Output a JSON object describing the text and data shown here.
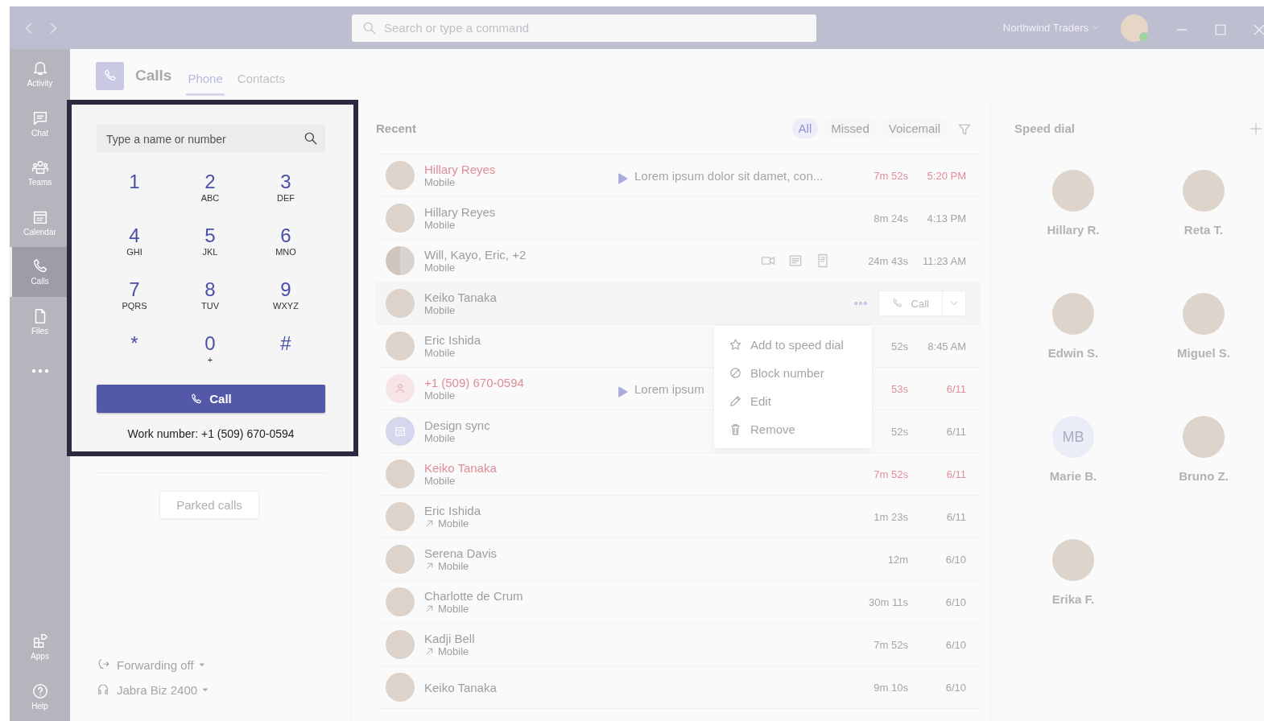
{
  "title_bar": {
    "search": {
      "placeholder": "Search or type a command"
    },
    "org": "Northwind Traders"
  },
  "rail": {
    "top": [
      {
        "label": "Activity",
        "selected": false
      },
      {
        "label": "Chat",
        "selected": false
      },
      {
        "label": "Teams",
        "selected": false
      },
      {
        "label": "Calendar",
        "selected": false
      },
      {
        "label": "Calls",
        "selected": true
      },
      {
        "label": "Files",
        "selected": false
      },
      {
        "selected": false
      }
    ],
    "bottom": [
      {
        "label": "Apps",
        "selected": false
      },
      {
        "label": "Help",
        "selected": false
      }
    ]
  },
  "app": {
    "title": "Calls",
    "tabs": [
      {
        "label": "Phone",
        "selected": true
      },
      {
        "label": "Contacts",
        "selected": false
      }
    ]
  },
  "dial_pad": {
    "search": {
      "placeholder": "Type a name or number"
    },
    "keys": [
      {
        "digit": "1"
      },
      {
        "digit": "2",
        "letters": "ABC"
      },
      {
        "digit": "3",
        "letters": "DEF"
      },
      {
        "digit": "4",
        "letters": "GHI"
      },
      {
        "digit": "5",
        "letters": "JKL"
      },
      {
        "digit": "6",
        "letters": "MNO"
      },
      {
        "digit": "7",
        "letters": "PQRS"
      },
      {
        "digit": "8",
        "letters": "TUV"
      },
      {
        "digit": "9",
        "letters": "WXYZ"
      },
      {
        "digit": "*"
      },
      {
        "digit": "0",
        "letters": "+"
      },
      {
        "digit": "#"
      }
    ],
    "call_button": "Call",
    "work_number": "Work number: +1 (509) 670-0594"
  },
  "parked_calls": "Parked calls",
  "forwarding": "Forwarding off",
  "device": "Jabra Biz 2400",
  "recent": {
    "title": "Recent",
    "filters": [
      {
        "label": "All",
        "selected": true
      },
      {
        "label": "Missed",
        "selected": false
      },
      {
        "label": "Voicemail",
        "selected": false
      }
    ],
    "rows": [
      {
        "name": "Hillary Reyes",
        "detail": "Mobile",
        "avatar": {
          "kind": "photo"
        },
        "kind": "voicemail",
        "preview": "Lorem ipsum dolor sit damet, con...",
        "missed": true,
        "outgoing": false,
        "selected": false,
        "duration": "7m 52s",
        "time": "5:20 PM"
      },
      {
        "name": "Hillary Reyes",
        "detail": "Mobile",
        "avatar": {
          "kind": "photo"
        },
        "kind": "plain",
        "missed": false,
        "outgoing": false,
        "selected": false,
        "duration": "8m 24s",
        "time": "4:13 PM"
      },
      {
        "name": "Will, Kayo, Eric, +2",
        "detail": "Mobile",
        "avatar": {
          "kind": "group"
        },
        "kind": "meeting",
        "missed": false,
        "outgoing": false,
        "selected": false,
        "duration": "24m 43s",
        "time": "11:23 AM"
      },
      {
        "name": "Keiko Tanaka",
        "detail": "Mobile",
        "avatar": {
          "kind": "photo"
        },
        "kind": "plain",
        "call_button": "Call",
        "missed": false,
        "outgoing": false,
        "selected": true
      },
      {
        "name": "Eric Ishida",
        "detail": "Mobile",
        "avatar": {
          "kind": "photo"
        },
        "kind": "plain",
        "missed": false,
        "outgoing": false,
        "selected": false,
        "duration": "52s",
        "time": "8:45 AM"
      },
      {
        "name": "+1 (509) 670-0594",
        "detail": "Mobile",
        "avatar": {
          "kind": "phone"
        },
        "kind": "voicemail",
        "preview": "Lorem ipsum",
        "missed": true,
        "outgoing": false,
        "selected": false,
        "duration": "53s",
        "time": "6/11"
      },
      {
        "name": "Design sync",
        "detail": "Mobile",
        "avatar": {
          "kind": "meeting"
        },
        "kind": "plain",
        "missed": false,
        "outgoing": false,
        "selected": false,
        "duration": "52s",
        "time": "6/11"
      },
      {
        "name": "Keiko Tanaka",
        "detail": "Mobile",
        "avatar": {
          "kind": "photo"
        },
        "kind": "plain",
        "missed": true,
        "outgoing": false,
        "selected": false,
        "duration": "7m 52s",
        "time": "6/11"
      },
      {
        "name": "Eric Ishida",
        "detail": "Mobile",
        "avatar": {
          "kind": "photo"
        },
        "kind": "plain",
        "missed": false,
        "outgoing": true,
        "selected": false,
        "duration": "1m 23s",
        "time": "6/11"
      },
      {
        "name": "Serena Davis",
        "detail": "Mobile",
        "avatar": {
          "kind": "photo"
        },
        "kind": "plain",
        "missed": false,
        "outgoing": true,
        "selected": false,
        "duration": "12m",
        "time": "6/10"
      },
      {
        "name": "Charlotte de Crum",
        "detail": "Mobile",
        "avatar": {
          "kind": "photo"
        },
        "kind": "plain",
        "missed": false,
        "outgoing": true,
        "selected": false,
        "duration": "30m 11s",
        "time": "6/10"
      },
      {
        "name": "Kadji Bell",
        "detail": "Mobile",
        "avatar": {
          "kind": "photo"
        },
        "kind": "plain",
        "missed": false,
        "outgoing": true,
        "selected": false,
        "duration": "7m 52s",
        "time": "6/10"
      },
      {
        "name": "Keiko Tanaka",
        "avatar": {
          "kind": "photo"
        },
        "kind": "plain",
        "missed": false,
        "selected": false,
        "duration": "9m 10s",
        "time": "6/10"
      }
    ]
  },
  "context_menu": [
    {
      "label": "Add to speed dial"
    },
    {
      "label": "Block number"
    },
    {
      "label": "Edit"
    },
    {
      "label": "Remove"
    }
  ],
  "speed_dial": {
    "title": "Speed dial",
    "contacts": [
      {
        "name": "Hillary R."
      },
      {
        "name": "Reta T."
      },
      {
        "name": "Edwin S."
      },
      {
        "name": "Miguel S."
      },
      {
        "name": "Marie B.",
        "initials": "MB"
      },
      {
        "name": "Bruno Z."
      },
      {
        "name": "Erika F."
      }
    ]
  }
}
